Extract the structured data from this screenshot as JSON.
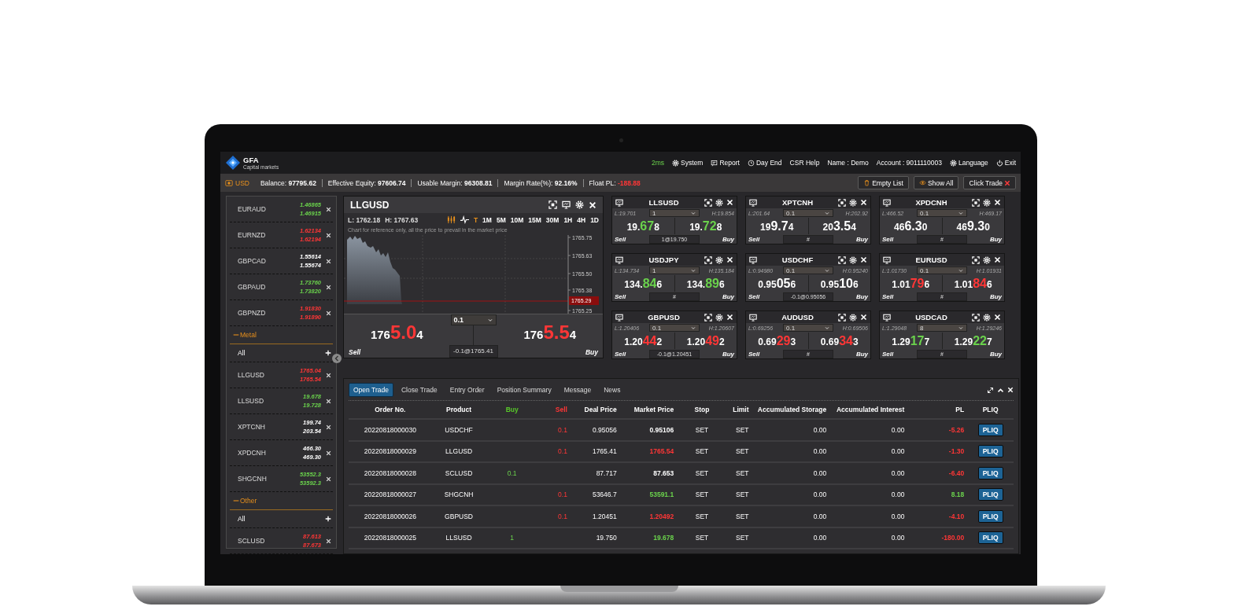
{
  "header": {
    "logo_text": "GFA",
    "logo_subtext": "Capital markets",
    "latency": "2ms",
    "menu": [
      {
        "label": "System",
        "kind": "gear"
      },
      {
        "label": "Report",
        "kind": "report"
      },
      {
        "label": "Day End",
        "kind": "clock"
      },
      {
        "label": "CSR Help",
        "kind": "link"
      },
      {
        "label": "Name : Demo",
        "kind": "info"
      },
      {
        "label": "Account : 9011110003",
        "kind": "info"
      },
      {
        "label": "Language",
        "kind": "gear"
      },
      {
        "label": "Exit",
        "kind": "power"
      }
    ]
  },
  "balance_bar": {
    "currency": "USD",
    "stats": [
      {
        "label": "Balance:",
        "value": "97795.62",
        "color": "#ffffff"
      },
      {
        "label": "Effective Equity:",
        "value": "97606.74",
        "color": "#ffffff"
      },
      {
        "label": "Usable Margin:",
        "value": "96308.81",
        "color": "#ffffff"
      },
      {
        "label": "Margin Rate(%):",
        "value": "92.16%",
        "color": "#ffffff"
      },
      {
        "label": "Float PL:",
        "value": "-188.88",
        "color": "#ff3636"
      }
    ],
    "buttons": [
      {
        "label": "Empty List",
        "kind": "trash"
      },
      {
        "label": "Show All",
        "kind": "eye"
      },
      {
        "label": "Click Trade",
        "kind": "close"
      }
    ]
  },
  "watchlist": {
    "sections": [
      {
        "items": [
          {
            "symbol": "EURAUD",
            "bid": "1.46865",
            "ask": "1.46915",
            "color": "#6ad24c"
          },
          {
            "symbol": "EURNZD",
            "bid": "1.62134",
            "ask": "1.62194",
            "color": "#ff3636"
          },
          {
            "symbol": "GBPCAD",
            "bid": "1.55614",
            "ask": "1.55674",
            "color": "#ffffff"
          },
          {
            "symbol": "GBPAUD",
            "bid": "1.73760",
            "ask": "1.73820",
            "color": "#6ad24c"
          },
          {
            "symbol": "GBPNZD",
            "bid": "1.91830",
            "ask": "1.91890",
            "color": "#ff3636"
          }
        ]
      },
      {
        "title": "Metal",
        "expanded": true,
        "filter": "All",
        "items": [
          {
            "symbol": "LLGUSD",
            "bid": "1765.04",
            "ask": "1765.54",
            "color": "#ff3636"
          },
          {
            "symbol": "LLSUSD",
            "bid": "19.678",
            "ask": "19.728",
            "color": "#6ad24c"
          },
          {
            "symbol": "XPTCNH",
            "bid": "199.74",
            "ask": "203.54",
            "color": "#ffffff"
          },
          {
            "symbol": "XPDCNH",
            "bid": "466.30",
            "ask": "469.30",
            "color": "#ffffff"
          },
          {
            "symbol": "SHGCNH",
            "bid": "53552.3",
            "ask": "53592.3",
            "color": "#6ad24c"
          }
        ]
      },
      {
        "title": "Other",
        "expanded": true,
        "filter": "All",
        "items": [
          {
            "symbol": "SCLUSD",
            "bid": "87.613",
            "ask": "87.673",
            "color": "#ff3636"
          }
        ]
      }
    ]
  },
  "chart": {
    "symbol": "LLGUSD",
    "low": "L: 1762.18",
    "high": "H: 1767.63",
    "chart_types": [
      {
        "kind": "candles",
        "selected": true
      },
      {
        "kind": "line",
        "selected": false
      }
    ],
    "timeframes": [
      {
        "label": "T",
        "selected": true
      },
      {
        "label": "1M",
        "selected": false
      },
      {
        "label": "5M",
        "selected": false
      },
      {
        "label": "10M",
        "selected": false
      },
      {
        "label": "15M",
        "selected": false
      },
      {
        "label": "30M",
        "selected": false
      },
      {
        "label": "1H",
        "selected": false
      },
      {
        "label": "4H",
        "selected": false
      },
      {
        "label": "1D",
        "selected": false
      }
    ],
    "note": "Chart for reference only, all the price to prevail in the market price",
    "axis_labels": [
      "1765.75",
      "1765.63",
      "1765.50",
      "1765.38",
      "1765.25"
    ],
    "current_price": "1765.29",
    "color": "#ff3636",
    "sell": {
      "prefix": "176",
      "pips": "5.0",
      "suffix": "4"
    },
    "buy": {
      "prefix": "176",
      "pips": "5.5",
      "suffix": "4"
    },
    "lot": "0.1",
    "position": "-0.1@1765.41",
    "sell_label": "Sell",
    "buy_label": "Buy"
  },
  "tiles": [
    {
      "symbol": "LLSUSD",
      "low": "L:19.701",
      "high": "H:19.854",
      "lot": "1",
      "color": "#6ad24c",
      "sell": {
        "prefix": "19.",
        "pips": "67",
        "suffix": "8"
      },
      "buy": {
        "prefix": "19.",
        "pips": "72",
        "suffix": "8"
      },
      "position": "1@19.750",
      "sell_label": "Sell",
      "buy_label": "Buy"
    },
    {
      "symbol": "XPTCNH",
      "low": "L:201.64",
      "high": "H:202.92",
      "lot": "0.1",
      "color": "#ffffff",
      "sell": {
        "prefix": "19",
        "pips": "9.7",
        "suffix": "4"
      },
      "buy": {
        "prefix": "20",
        "pips": "3.5",
        "suffix": "4"
      },
      "position": "#",
      "sell_label": "Sell",
      "buy_label": "Buy"
    },
    {
      "symbol": "XPDCNH",
      "low": "L:466.52",
      "high": "H:469.17",
      "lot": "0.1",
      "color": "#ffffff",
      "sell": {
        "prefix": "46",
        "pips": "6.3",
        "suffix": "0"
      },
      "buy": {
        "prefix": "46",
        "pips": "9.3",
        "suffix": "0"
      },
      "position": "#",
      "sell_label": "Sell",
      "buy_label": "Buy"
    },
    {
      "symbol": "USDJPY",
      "low": "L:134.734",
      "high": "H:135.184",
      "lot": "1",
      "color": "#6ad24c",
      "sell": {
        "prefix": "134.",
        "pips": "84",
        "suffix": "6"
      },
      "buy": {
        "prefix": "134.",
        "pips": "89",
        "suffix": "6"
      },
      "position": "#",
      "sell_label": "Sell",
      "buy_label": "Buy"
    },
    {
      "symbol": "USDCHF",
      "low": "L:0.94980",
      "high": "H:0.95240",
      "lot": "0.1",
      "color": "#ffffff",
      "sell": {
        "prefix": "0.95",
        "pips": "05",
        "suffix": "6"
      },
      "buy": {
        "prefix": "0.95",
        "pips": "10",
        "suffix": "6"
      },
      "position": "-0.1@0.95056",
      "sell_label": "Sell",
      "buy_label": "Buy"
    },
    {
      "symbol": "EURUSD",
      "low": "L:1.01730",
      "high": "H:1.01931",
      "lot": "0.1",
      "color": "#ff3636",
      "sell": {
        "prefix": "1.01",
        "pips": "79",
        "suffix": "6"
      },
      "buy": {
        "prefix": "1.01",
        "pips": "84",
        "suffix": "6"
      },
      "position": "#",
      "sell_label": "Sell",
      "buy_label": "Buy"
    },
    {
      "symbol": "GBPUSD",
      "low": "L:1.20406",
      "high": "H:1.20607",
      "lot": "0.1",
      "color": "#ff3636",
      "sell": {
        "prefix": "1.20",
        "pips": "44",
        "suffix": "2"
      },
      "buy": {
        "prefix": "1.20",
        "pips": "49",
        "suffix": "2"
      },
      "position": "-0.1@1.20451",
      "sell_label": "Sell",
      "buy_label": "Buy"
    },
    {
      "symbol": "AUDUSD",
      "low": "L:0.69256",
      "high": "H:0.69506",
      "lot": "0.1",
      "color": "#ff3636",
      "sell": {
        "prefix": "0.69",
        "pips": "29",
        "suffix": "3"
      },
      "buy": {
        "prefix": "0.69",
        "pips": "34",
        "suffix": "3"
      },
      "position": "#",
      "sell_label": "Sell",
      "buy_label": "Buy"
    },
    {
      "symbol": "USDCAD",
      "low": "L:1.29048",
      "high": "H:1.29246",
      "lot": "8",
      "color": "#6ad24c",
      "sell": {
        "prefix": "1.29",
        "pips": "17",
        "suffix": "7"
      },
      "buy": {
        "prefix": "1.29",
        "pips": "22",
        "suffix": "7"
      },
      "position": "#",
      "sell_label": "Sell",
      "buy_label": "Buy"
    }
  ],
  "trades": {
    "tabs": [
      {
        "label": "Open Trade",
        "selected": true
      },
      {
        "label": "Close Trade",
        "selected": false
      },
      {
        "label": "Entry Order",
        "selected": false
      },
      {
        "label": "Position Summary",
        "selected": false
      },
      {
        "label": "Message",
        "selected": false
      },
      {
        "label": "News",
        "selected": false
      }
    ],
    "columns": [
      {
        "label": "Order No.",
        "kind": "text"
      },
      {
        "label": "Product",
        "kind": "text"
      },
      {
        "label": "Buy",
        "kind": "buy"
      },
      {
        "label": "Sell",
        "kind": "sell"
      },
      {
        "label": "Deal Price",
        "kind": "text"
      },
      {
        "label": "Market Price",
        "kind": "text"
      },
      {
        "label": "Stop",
        "kind": "text"
      },
      {
        "label": "Limit",
        "kind": "text"
      },
      {
        "label": "Accumulated Storage",
        "kind": "text"
      },
      {
        "label": "Accumulated Interest",
        "kind": "text"
      },
      {
        "label": "PL",
        "kind": "text"
      },
      {
        "label": "PLIQ",
        "kind": "text"
      }
    ],
    "rows": [
      {
        "order_no": "20220818000030",
        "product": "USDCHF",
        "sell": "0.1",
        "deal_price": "0.95056",
        "market_price": {
          "text": "0.95106",
          "color": "#ffffff"
        },
        "stop": "SET",
        "limit": "SET",
        "storage": "0.00",
        "interest": "0.00",
        "pl": {
          "text": "-5.26",
          "color": "#ff3636"
        },
        "action": "PLIQ"
      },
      {
        "order_no": "20220818000029",
        "product": "LLGUSD",
        "sell": "0.1",
        "deal_price": "1765.41",
        "market_price": {
          "text": "1765.54",
          "color": "#ff3636"
        },
        "stop": "SET",
        "limit": "SET",
        "storage": "0.00",
        "interest": "0.00",
        "pl": {
          "text": "-1.30",
          "color": "#ff3636"
        },
        "action": "PLIQ"
      },
      {
        "order_no": "20220818000028",
        "product": "SCLUSD",
        "buy": "0.1",
        "deal_price": "87.717",
        "market_price": {
          "text": "87.653",
          "color": "#ffffff"
        },
        "stop": "SET",
        "limit": "SET",
        "storage": "0.00",
        "interest": "0.00",
        "pl": {
          "text": "-6.40",
          "color": "#ff3636"
        },
        "action": "PLIQ"
      },
      {
        "order_no": "20220818000027",
        "product": "SHGCNH",
        "sell": "0.1",
        "deal_price": "53646.7",
        "market_price": {
          "text": "53591.1",
          "color": "#6ad24c"
        },
        "stop": "SET",
        "limit": "SET",
        "storage": "0.00",
        "interest": "0.00",
        "pl": {
          "text": "8.18",
          "color": "#6ad24c"
        },
        "action": "PLIQ"
      },
      {
        "order_no": "20220818000026",
        "product": "GBPUSD",
        "sell": "0.1",
        "deal_price": "1.20451",
        "market_price": {
          "text": "1.20492",
          "color": "#ff3636"
        },
        "stop": "SET",
        "limit": "SET",
        "storage": "0.00",
        "interest": "0.00",
        "pl": {
          "text": "-4.10",
          "color": "#ff3636"
        },
        "action": "PLIQ"
      },
      {
        "order_no": "20220818000025",
        "product": "LLSUSD",
        "buy": "1",
        "deal_price": "19.750",
        "market_price": {
          "text": "19.678",
          "color": "#6ad24c"
        },
        "stop": "SET",
        "limit": "SET",
        "storage": "0.00",
        "interest": "0.00",
        "pl": {
          "text": "-180.00",
          "color": "#ff3636"
        },
        "action": "PLIQ"
      }
    ]
  }
}
